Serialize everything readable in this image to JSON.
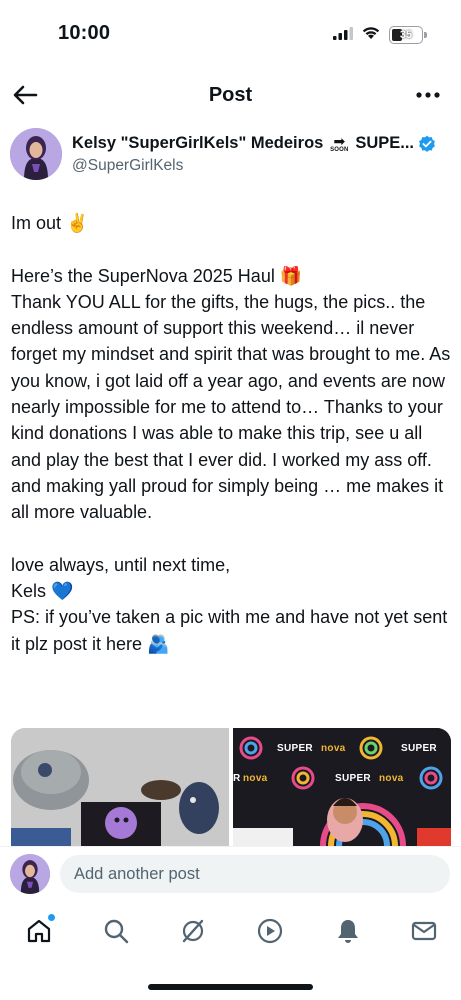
{
  "status_bar": {
    "time": "10:00",
    "battery": "35"
  },
  "header": {
    "title": "Post"
  },
  "author": {
    "name": "Kelsy \"SuperGirlKels\" Medeiros",
    "soon_badge": "SOON",
    "name_tail": "SUPE...",
    "handle": "@SuperGirlKels",
    "verified": true
  },
  "post": {
    "lines": [
      "Im out ✌️",
      "",
      "Here’s the SuperNova 2025 Haul 🎁",
      "Thank YOU ALL for the gifts, the hugs, the pics.. the endless amount of support this weekend… il never forget my mindset and spirit that was brought to me. As you know, i got laid off a year ago, and events are now nearly impossible for me to attend to… Thanks to your kind donations I was able to make this trip, see u all and play the best that I ever did. I worked my ass off. and making yall proud for simply being … me makes it all more valuable.",
      "",
      "love always, until next time,",
      "Kels 💙",
      "PS: if you’ve taken a pic with me and have not yet sent it plz post it here 🫂"
    ]
  },
  "media": {
    "backdrop_texts": [
      "SUPER",
      "nova",
      "SUPER",
      "R",
      "nova",
      "SUPER",
      "nova"
    ]
  },
  "reply": {
    "placeholder": "Add another post"
  },
  "tabbar": {
    "items": [
      "home-icon",
      "search-icon",
      "grok-icon",
      "video-icon",
      "notifications-icon",
      "messages-icon"
    ],
    "accent": "#1d9bf0"
  }
}
